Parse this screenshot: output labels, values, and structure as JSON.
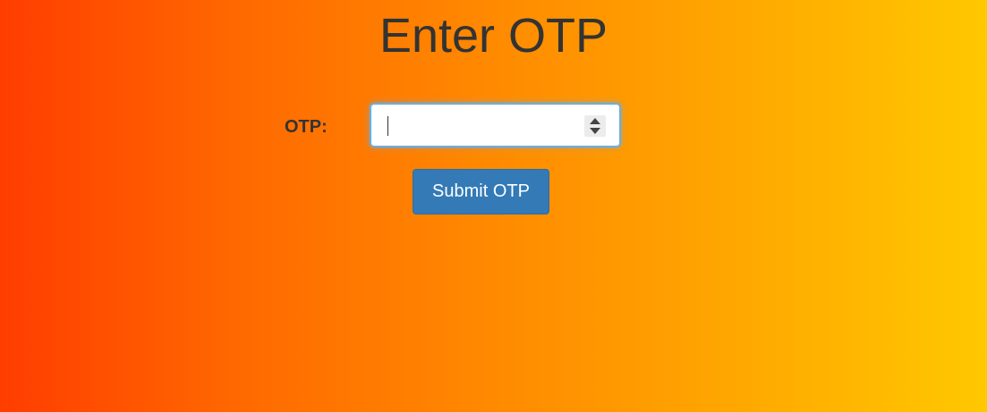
{
  "page": {
    "title": "Enter OTP"
  },
  "form": {
    "otp_label": "OTP:",
    "otp_value": "",
    "otp_input_type": "number",
    "submit_label": "Submit OTP"
  },
  "icons": {
    "spinner": "number-spinner-icon"
  },
  "colors": {
    "gradient_start": "#ff3d00",
    "gradient_end": "#ffc800",
    "button_primary": "#337ab7",
    "input_focus_border": "#66afe9",
    "text_dark": "#333333"
  }
}
